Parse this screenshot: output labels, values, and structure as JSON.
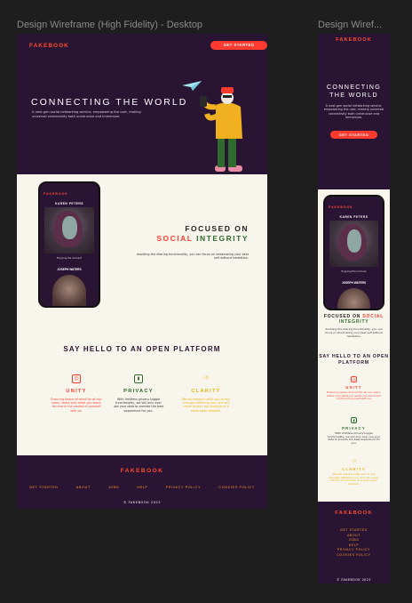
{
  "canvas": {
    "desktop_frame_label": "Design Wireframe (High Fidelity) - Desktop",
    "mobile_frame_label": "Design Wiref..."
  },
  "colors": {
    "dark_purple": "#2a1433",
    "cream": "#f8f6ec",
    "accent_red": "#ff3b2f",
    "accent_green": "#2e6b2c",
    "accent_yellow": "#e9b01c",
    "footer_link": "#ff9a2a"
  },
  "brand": {
    "logo": "FAKEBOOK"
  },
  "hero": {
    "cta": "GET STARTED",
    "title": "CONNECTING THE WORLD",
    "subtitle": "A next-gen social networking service, empowering the user, making universal connectivity both unintrusive and immersive."
  },
  "phone": {
    "profile_name": "KAREN PETERS",
    "caption": "Enjoying the moment",
    "second_profile_name": "JOSEPH WATERS"
  },
  "feature": {
    "title_line1": "FOCUSED ON",
    "title_word_social": "SOCIAL",
    "title_word_integrity": "INTEGRITY",
    "description": "Avoiding the sharing functionality, you can focus on showcasing your best self without hesitation."
  },
  "platform": {
    "title": "SAY HELLO TO AN OPEN PLATFORM",
    "pillars": [
      {
        "title": "UNITY",
        "icon": "smile-square-icon",
        "description": "Ensuring peace of mind for all our users, share only what you want. You are in full control of yourself with us."
      },
      {
        "title": "PRIVACY",
        "icon": "lock-square-icon",
        "description": "With limitless privacy toggle functionality, we will only ever use your data to provide the best experience for you."
      },
      {
        "title": "CLARITY",
        "icon": "megaphone-icon",
        "description": "We will always notify you of any changes affecting you, and will never breach our promise of a clean open network."
      }
    ]
  },
  "footer": {
    "links": [
      "GET STARTED",
      "ABOUT",
      "JOBS",
      "HELP",
      "PRIVACY POLICY",
      "COOKIES POLICY"
    ],
    "copyright": "© FAKEBOOK 2022"
  }
}
